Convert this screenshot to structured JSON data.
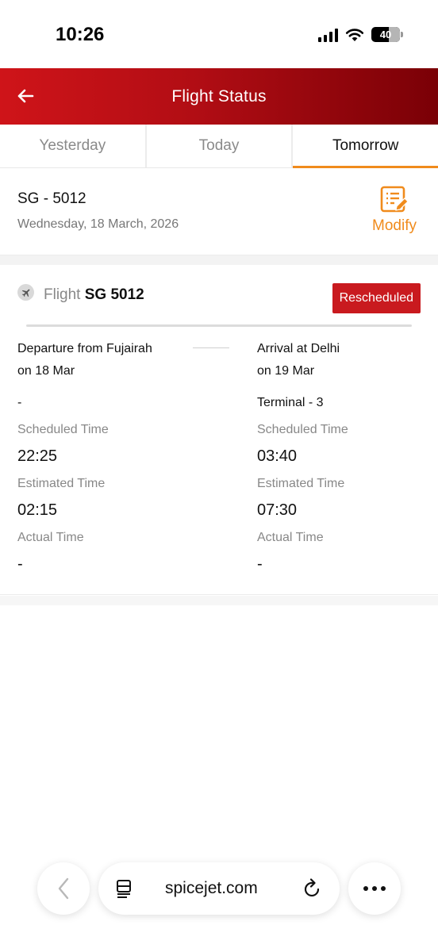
{
  "status_bar": {
    "time": "10:26",
    "battery": "40"
  },
  "header": {
    "title": "Flight Status"
  },
  "tabs": [
    {
      "label": "Yesterday",
      "active": false
    },
    {
      "label": "Today",
      "active": false
    },
    {
      "label": "Tomorrow",
      "active": true
    }
  ],
  "summary": {
    "flight_number": "SG - 5012",
    "date": "Wednesday, 18 March, 2026",
    "modify_label": "Modify"
  },
  "details": {
    "flight_prefix": "Flight",
    "flight_code": "SG 5012",
    "status": "Rescheduled",
    "departure": {
      "location": "Departure from Fujairah",
      "date": "on 18 Mar",
      "terminal": "-",
      "scheduled_label": "Scheduled Time",
      "scheduled": "22:25",
      "estimated_label": "Estimated Time",
      "estimated": "02:15",
      "actual_label": "Actual Time",
      "actual": "-"
    },
    "arrival": {
      "location": "Arrival at Delhi",
      "date": "on 19 Mar",
      "terminal": "Terminal - 3",
      "scheduled_label": "Scheduled Time",
      "scheduled": "03:40",
      "estimated_label": "Estimated Time",
      "estimated": "07:30",
      "actual_label": "Actual Time",
      "actual": "-"
    }
  },
  "browser": {
    "url": "spicejet.com"
  },
  "colors": {
    "brand_red": "#c91a1f",
    "accent_orange": "#f08b1c"
  },
  "icons": [
    "arrow-left-icon",
    "edit-document-icon",
    "plane-icon",
    "chevron-left-icon",
    "reader-icon",
    "reload-icon",
    "more-icon"
  ]
}
